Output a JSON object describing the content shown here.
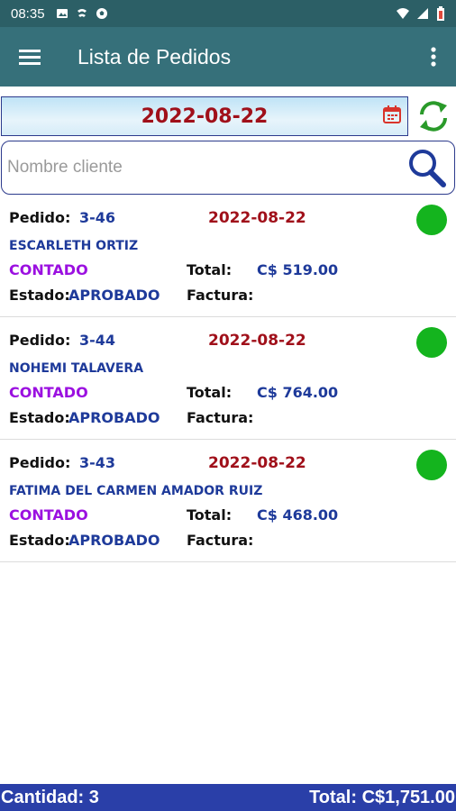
{
  "status_bar": {
    "time": "08:35"
  },
  "app_bar": {
    "title": "Lista de Pedidos"
  },
  "filter": {
    "date": "2022-08-22"
  },
  "search": {
    "placeholder": "Nombre cliente",
    "value": ""
  },
  "labels": {
    "pedido": "Pedido:",
    "total": "Total:",
    "estado": "Estado:",
    "factura": "Factura:"
  },
  "orders": [
    {
      "number": "3-46",
      "date": "2022-08-22",
      "client": "ESCARLETH ORTIZ",
      "payment": "CONTADO",
      "total": "C$ 519.00",
      "status": "APROBADO",
      "invoice": ""
    },
    {
      "number": "3-44",
      "date": "2022-08-22",
      "client": "NOHEMI TALAVERA",
      "payment": "CONTADO",
      "total": "C$ 764.00",
      "status": "APROBADO",
      "invoice": ""
    },
    {
      "number": "3-43",
      "date": "2022-08-22",
      "client": "FATIMA DEL CARMEN AMADOR RUIZ",
      "payment": "CONTADO",
      "total": "C$ 468.00",
      "status": "APROBADO",
      "invoice": ""
    }
  ],
  "footer": {
    "count": "Cantidad: 3",
    "total": "Total: C$1,751.00"
  },
  "colors": {
    "app_bar": "#36707a",
    "status_bar": "#2c5f66",
    "date_text": "#a0101a",
    "blue_text": "#1e3a9a",
    "payment_text": "#9b10e0",
    "status_dot": "#14b41e",
    "footer": "#2a3fa8"
  },
  "icons": [
    "image-icon",
    "cast-icon",
    "soccer-ball-icon",
    "wifi-icon",
    "signal-icon",
    "battery-icon",
    "menu-icon",
    "more-vert-icon",
    "calendar-icon",
    "refresh-icon",
    "search-icon"
  ]
}
